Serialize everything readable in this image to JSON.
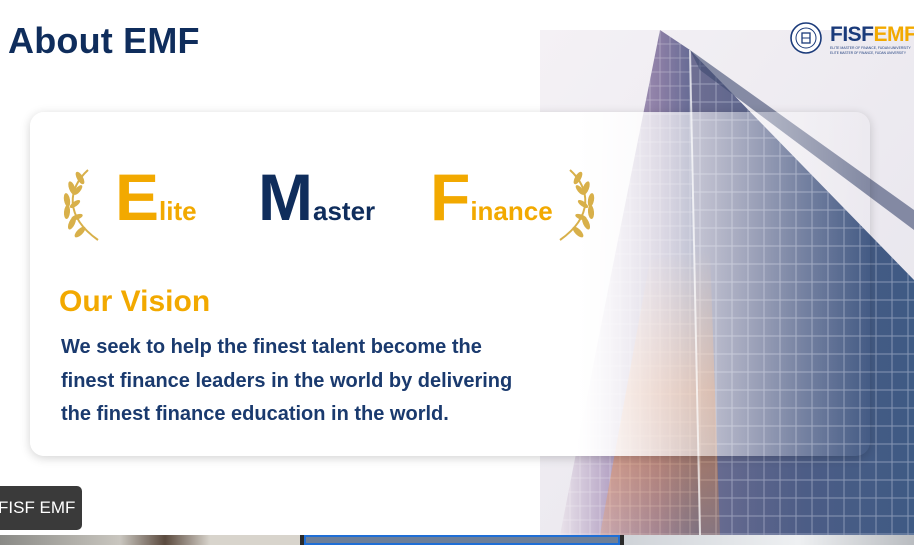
{
  "slide": {
    "title": "About EMF",
    "acronym": [
      {
        "initial": "E",
        "rest": "lite",
        "color": "#f2a900"
      },
      {
        "initial": "M",
        "rest": "aster",
        "color": "#0f2d5c"
      },
      {
        "initial": "F",
        "rest": "inance",
        "color": "#f2a900"
      }
    ],
    "vision_heading": "Our Vision",
    "vision_lines": [
      "We seek to help the finest talent become the",
      "finest finance leaders in the world by delivering",
      "the finest finance education in the world."
    ]
  },
  "logo": {
    "part1": "FISF",
    "part2": "EMF",
    "subtitle": "ELITE MASTER OF FINANCE, FUDAN UNIVERSITY",
    "icon": "university-seal-icon"
  },
  "participant": {
    "name_tag": "FISF EMF"
  },
  "video_strip": {
    "tiles": 3,
    "active_tile": 2
  },
  "colors": {
    "navy": "#0f2d5c",
    "gold": "#f2a900",
    "text_blue": "#1a3a6e",
    "active_border": "#1f6fd6"
  }
}
